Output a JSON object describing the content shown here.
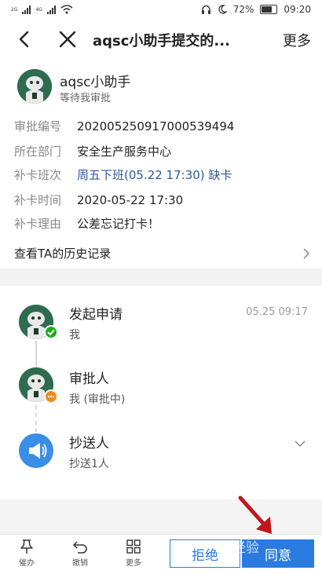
{
  "status_bar": {
    "net1": "2G",
    "net2": "4G",
    "battery": "72%",
    "time": "09:20"
  },
  "nav": {
    "title": "aqsc小助手提交的...",
    "more": "更多"
  },
  "header": {
    "applicant": "aqsc小助手",
    "status": "等待我审批"
  },
  "details": [
    {
      "label": "审批编号",
      "value": "20200525091700053949​4"
    },
    {
      "label": "所在部门",
      "value": "安全生产服务中心"
    },
    {
      "label": "补卡班次",
      "value": "周五下班(05.22 17:30) 缺卡"
    },
    {
      "label": "补卡时间",
      "value": "2020-05-22 17:30"
    },
    {
      "label": "补卡理由",
      "value": "公差忘记打卡！"
    }
  ],
  "history_link": "查看TA的历史记录",
  "flow": {
    "steps": [
      {
        "title": "发起申请",
        "sub": "我",
        "time": "05.25 09:17"
      },
      {
        "title": "审批人",
        "sub": "我 (审批中)"
      },
      {
        "title": "抄送人",
        "sub": "抄送1人"
      }
    ]
  },
  "bottom": {
    "urge": "催办",
    "revoke": "撤销",
    "more": "更多",
    "reject": "拒绝",
    "agree": "同意"
  },
  "watermark": "经验",
  "colors": {
    "accent": "#2a7be0",
    "link": "#2a5b9a",
    "success": "#1aad19",
    "pending": "#f08a24",
    "annotation_arrow": "#c0161b"
  }
}
